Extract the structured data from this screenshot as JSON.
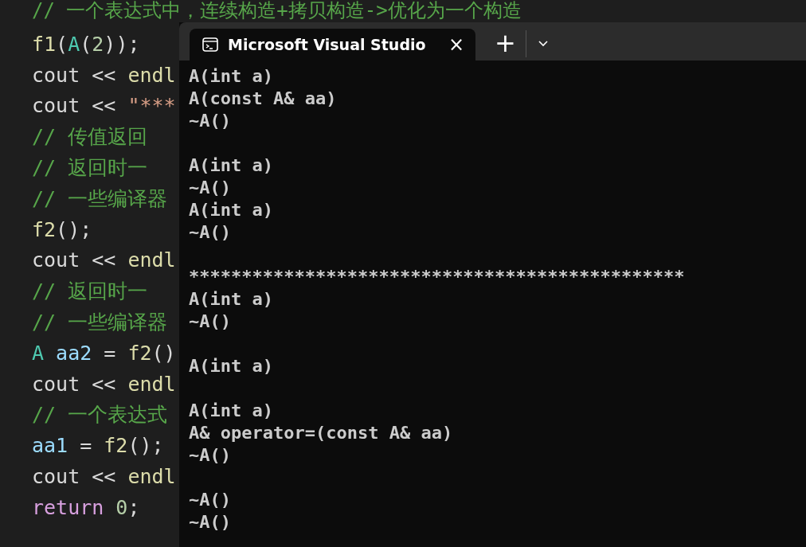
{
  "editor": {
    "lines": [
      [
        {
          "kind": "comment",
          "text": "// 一个表达式中，连续构造+拷贝构造->优化为一个构造"
        }
      ],
      [
        {
          "kind": "func",
          "text": "f1"
        },
        {
          "kind": "plain",
          "text": "("
        },
        {
          "kind": "type",
          "text": "A"
        },
        {
          "kind": "plain",
          "text": "("
        },
        {
          "kind": "number",
          "text": "2"
        },
        {
          "kind": "plain",
          "text": "));"
        }
      ],
      [
        {
          "kind": "plain",
          "text": "cout << "
        },
        {
          "kind": "func",
          "text": "endl"
        }
      ],
      [
        {
          "kind": "plain",
          "text": "cout << "
        },
        {
          "kind": "string",
          "text": "\"***"
        }
      ],
      [
        {
          "kind": "comment",
          "text": "// 传值返回"
        }
      ],
      [
        {
          "kind": "comment",
          "text": "// 返回时一"
        }
      ],
      [
        {
          "kind": "comment",
          "text": "// 一些编译器"
        }
      ],
      [
        {
          "kind": "func",
          "text": "f2"
        },
        {
          "kind": "plain",
          "text": "();"
        }
      ],
      [
        {
          "kind": "plain",
          "text": "cout << "
        },
        {
          "kind": "func",
          "text": "endl"
        }
      ],
      [
        {
          "kind": "comment",
          "text": "// 返回时一"
        }
      ],
      [
        {
          "kind": "comment",
          "text": "// 一些编译器"
        }
      ],
      [
        {
          "kind": "type",
          "text": "A "
        },
        {
          "kind": "var",
          "text": "aa2"
        },
        {
          "kind": "plain",
          "text": " = "
        },
        {
          "kind": "func",
          "text": "f2"
        },
        {
          "kind": "plain",
          "text": "()"
        }
      ],
      [
        {
          "kind": "plain",
          "text": "cout << "
        },
        {
          "kind": "func",
          "text": "endl"
        }
      ],
      [
        {
          "kind": "comment",
          "text": "// 一个表达式"
        }
      ],
      [
        {
          "kind": "var",
          "text": "aa1"
        },
        {
          "kind": "plain",
          "text": " = "
        },
        {
          "kind": "func",
          "text": "f2"
        },
        {
          "kind": "plain",
          "text": "();"
        }
      ],
      [
        {
          "kind": "plain",
          "text": "cout << "
        },
        {
          "kind": "func",
          "text": "endl"
        }
      ],
      [
        {
          "kind": "keyword",
          "text": "return "
        },
        {
          "kind": "number",
          "text": "0"
        },
        {
          "kind": "plain",
          "text": ";"
        }
      ]
    ]
  },
  "terminal": {
    "tabs": [
      {
        "title": "Microsoft Visual Studio",
        "selected": true,
        "close": "×"
      }
    ],
    "new_tab": "+",
    "output_blocks": [
      [
        "A(int a)",
        "A(const A& aa)",
        "~A()"
      ],
      [
        "A(int a)",
        "~A()",
        "A(int a)",
        "~A()"
      ],
      [
        "***********************************************",
        "A(int a)",
        "~A()"
      ],
      [
        "A(int a)"
      ],
      [
        "A(int a)",
        "A& operator=(const A& aa)",
        "~A()"
      ],
      [
        "~A()",
        "~A()"
      ]
    ]
  }
}
